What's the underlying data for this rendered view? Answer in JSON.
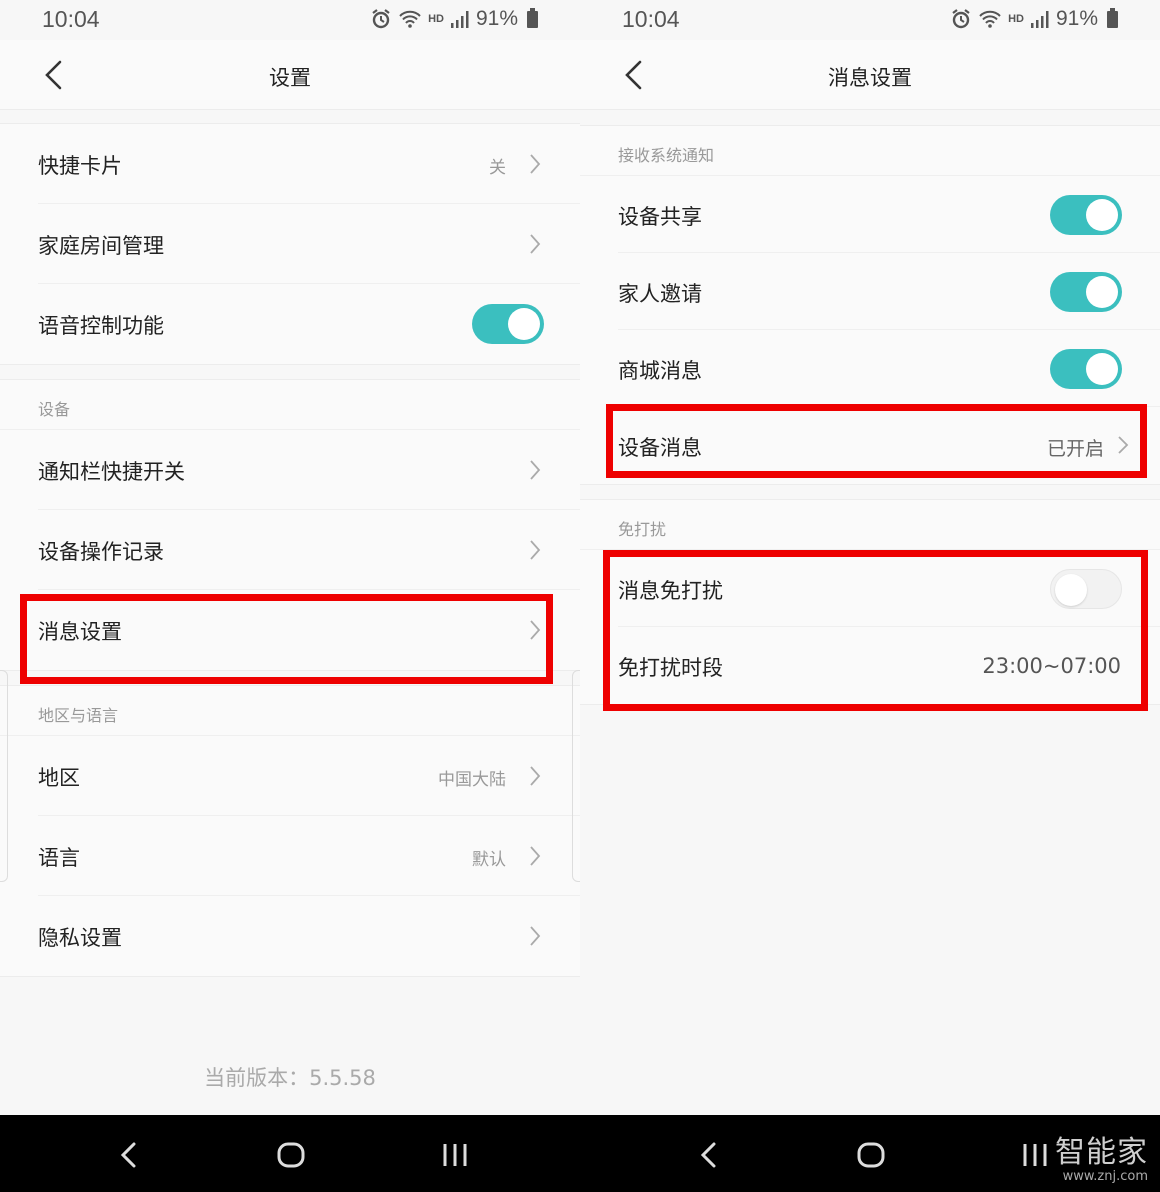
{
  "status_bar": {
    "time": "10:04",
    "hd": "HD",
    "battery": "91%"
  },
  "left": {
    "title": "设置",
    "rows_top": [
      {
        "label": "快捷卡片",
        "value": "关"
      },
      {
        "label": "家庭房间管理",
        "value": ""
      },
      {
        "label": "语音控制功能",
        "toggle": true
      }
    ],
    "section_device": "设备",
    "rows_device": [
      {
        "label": "通知栏快捷开关"
      },
      {
        "label": "设备操作记录"
      },
      {
        "label": "消息设置"
      }
    ],
    "section_region": "地区与语言",
    "rows_region": [
      {
        "label": "地区",
        "value": "中国大陆"
      },
      {
        "label": "语言",
        "value": "默认"
      },
      {
        "label": "隐私设置",
        "value": ""
      }
    ],
    "version": "当前版本：5.5.58"
  },
  "right": {
    "title": "消息设置",
    "section_notify": "接收系统通知",
    "rows_notify": [
      {
        "label": "设备共享",
        "toggle": true
      },
      {
        "label": "家人邀请",
        "toggle": true
      },
      {
        "label": "商城消息",
        "toggle": true
      },
      {
        "label": "设备消息",
        "value": "已开启"
      }
    ],
    "section_dnd": "免打扰",
    "rows_dnd": [
      {
        "label": "消息免打扰",
        "toggle": false
      },
      {
        "label": "免打扰时段",
        "value": "23:00~07:00"
      }
    ]
  },
  "watermark": {
    "text": "智能家",
    "url": "www.znj.com"
  },
  "colors": {
    "accent": "#3bbfbf",
    "highlight": "#ee0000"
  }
}
